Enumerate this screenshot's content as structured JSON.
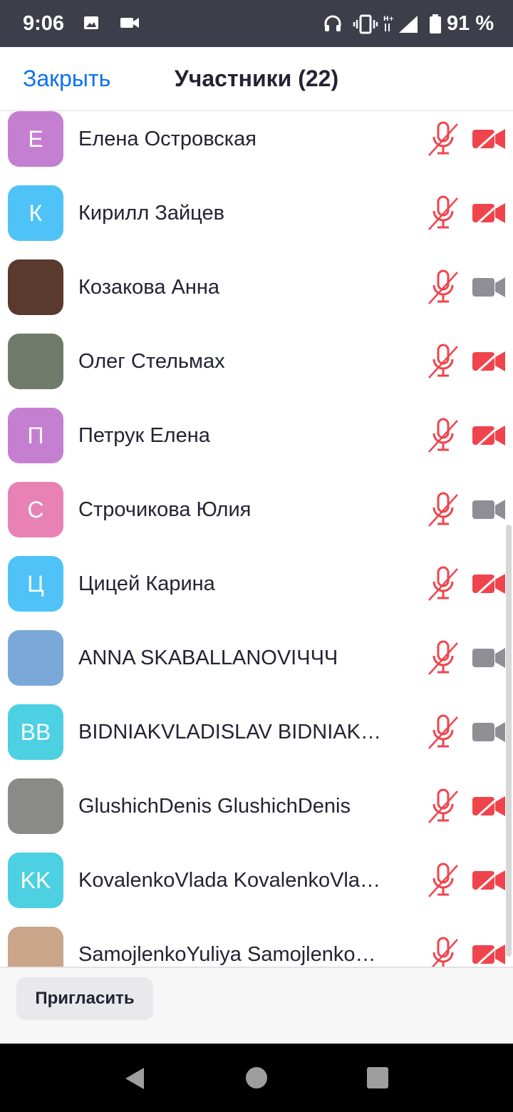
{
  "status_bar": {
    "time": "9:06",
    "battery": "91 %"
  },
  "header": {
    "close_label": "Закрыть",
    "title": "Участники (22)"
  },
  "participants": [
    {
      "initials": "Е",
      "name": "Елена Островская",
      "avatar_color": "#c57fd1",
      "mic_muted": true,
      "video_off": true
    },
    {
      "initials": "К",
      "name": "Кирилл Зайцев",
      "avatar_color": "#4fc3f7",
      "mic_muted": true,
      "video_off": true
    },
    {
      "initials": "",
      "name": "Козакова Анна",
      "avatar_color": "#5a3a2e",
      "mic_muted": true,
      "video_off": false
    },
    {
      "initials": "",
      "name": "Олег Стельмах",
      "avatar_color": "#6f7a6a",
      "mic_muted": true,
      "video_off": true
    },
    {
      "initials": "П",
      "name": "Петрук Елена",
      "avatar_color": "#c57fd1",
      "mic_muted": true,
      "video_off": true
    },
    {
      "initials": "С",
      "name": "Строчикова Юлия",
      "avatar_color": "#e882b4",
      "mic_muted": true,
      "video_off": false
    },
    {
      "initials": "Ц",
      "name": "Цицей Карина",
      "avatar_color": "#4fc3f7",
      "mic_muted": true,
      "video_off": true
    },
    {
      "initials": "",
      "name": "ANNA SKABALLANOVIЧЧЧ",
      "avatar_color": "#7aa8d8",
      "mic_muted": true,
      "video_off": false
    },
    {
      "initials": "BB",
      "name": "BIDNIAKVLADISLAV BIDNIAKVLADISLAV",
      "avatar_color": "#4dd0e1",
      "mic_muted": true,
      "video_off": false
    },
    {
      "initials": "",
      "name": "GlushichDenis GlushichDenis",
      "avatar_color": "#8a8a86",
      "mic_muted": true,
      "video_off": true
    },
    {
      "initials": "KK",
      "name": "KovalenkoVlada KovalenkoVlada",
      "avatar_color": "#4dd0e1",
      "mic_muted": true,
      "video_off": true
    },
    {
      "initials": "",
      "name": "SamojlenkoYuliya SamojlenkoYuliya",
      "avatar_color": "#c9a58a",
      "mic_muted": true,
      "video_off": true
    }
  ],
  "footer": {
    "invite_label": "Пригласить"
  },
  "colors": {
    "accent": "#0e72ed",
    "muted_red": "#f0444d",
    "video_on_gray": "#8e8e94"
  }
}
